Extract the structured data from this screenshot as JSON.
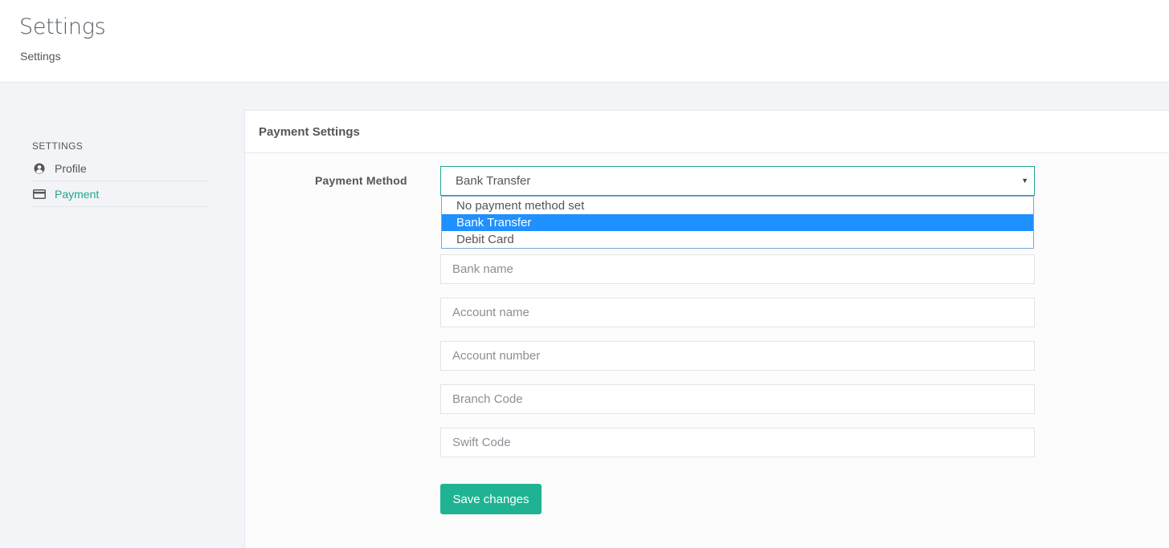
{
  "header": {
    "title": "Settings",
    "breadcrumb": "Settings"
  },
  "sidebar": {
    "heading": "SETTINGS",
    "items": [
      {
        "label": "Profile",
        "icon": "user-circle-icon",
        "active": false
      },
      {
        "label": "Payment",
        "icon": "credit-card-icon",
        "active": true
      }
    ]
  },
  "panel": {
    "title": "Payment Settings",
    "payment_method_label": "Payment Method",
    "payment_method_value": "Bank Transfer",
    "options": [
      {
        "label": "No payment method set",
        "selected": false
      },
      {
        "label": "Bank Transfer",
        "selected": true
      },
      {
        "label": "Debit Card",
        "selected": false
      }
    ],
    "fields": {
      "bank_name_placeholder": "Bank name",
      "account_name_placeholder": "Account name",
      "account_number_placeholder": "Account number",
      "branch_code_placeholder": "Branch Code",
      "swift_code_placeholder": "Swift Code"
    },
    "save_label": "Save changes"
  },
  "colors": {
    "accent": "#1fb393",
    "active_text": "#1fa78c",
    "selected_option": "#1e90ff"
  }
}
